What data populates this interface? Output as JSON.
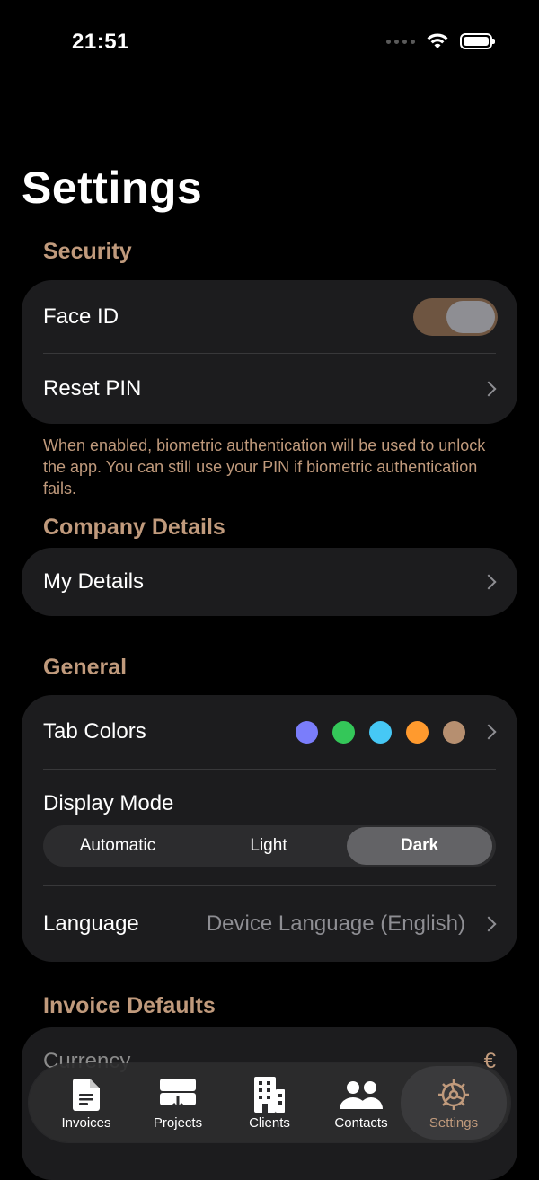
{
  "status": {
    "time": "21:51"
  },
  "page": {
    "title": "Settings"
  },
  "security": {
    "header": "Security",
    "face_id_label": "Face ID",
    "face_id_on": true,
    "reset_pin_label": "Reset PIN",
    "footnote": "When enabled, biometric authentication will be used to unlock the app. You can still use your PIN if biometric authentication fails."
  },
  "company": {
    "header": "Company Details",
    "my_details_label": "My Details"
  },
  "general": {
    "header": "General",
    "tab_colors_label": "Tab Colors",
    "tab_colors": [
      "#7a7dfb",
      "#34c759",
      "#46c8f5",
      "#ff9a2e",
      "#b68f70"
    ],
    "display_mode_label": "Display Mode",
    "display_modes": [
      "Automatic",
      "Light",
      "Dark"
    ],
    "display_mode_selected": "Dark",
    "language_label": "Language",
    "language_value": "Device Language (English)"
  },
  "invoice_defaults": {
    "header": "Invoice Defaults",
    "currency_label": "Currency",
    "currency_value": "€"
  },
  "tabbar": {
    "items": [
      {
        "label": "Invoices",
        "icon": "document-icon"
      },
      {
        "label": "Projects",
        "icon": "projects-icon"
      },
      {
        "label": "Clients",
        "icon": "building-icon"
      },
      {
        "label": "Contacts",
        "icon": "people-icon"
      },
      {
        "label": "Settings",
        "icon": "gear-icon"
      }
    ],
    "active": "Settings"
  },
  "colors": {
    "accent": "#c09a7c",
    "toggle_on": "#6e5541",
    "card": "#1c1c1e"
  }
}
